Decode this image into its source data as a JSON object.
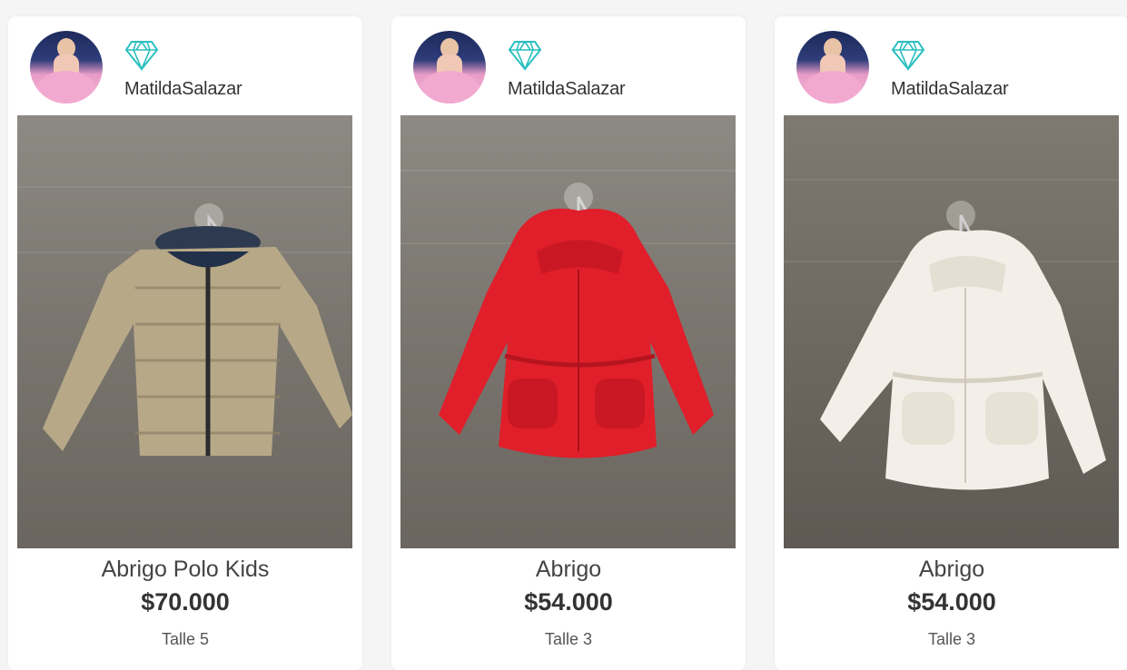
{
  "accent_color": "#2bbfbf",
  "products": [
    {
      "seller": "MatildaSalazar",
      "seller_badge": "diamond-icon",
      "title": "Abrigo Polo Kids",
      "price": "$70.000",
      "size": "Talle 5",
      "item_color": "#b7a988"
    },
    {
      "seller": "MatildaSalazar",
      "seller_badge": "diamond-icon",
      "title": "Abrigo",
      "price": "$54.000",
      "size": "Talle 3",
      "item_color": "#e01f2b"
    },
    {
      "seller": "MatildaSalazar",
      "seller_badge": "diamond-icon",
      "title": "Abrigo",
      "price": "$54.000",
      "size": "Talle 3",
      "item_color": "#f3efe8"
    }
  ]
}
